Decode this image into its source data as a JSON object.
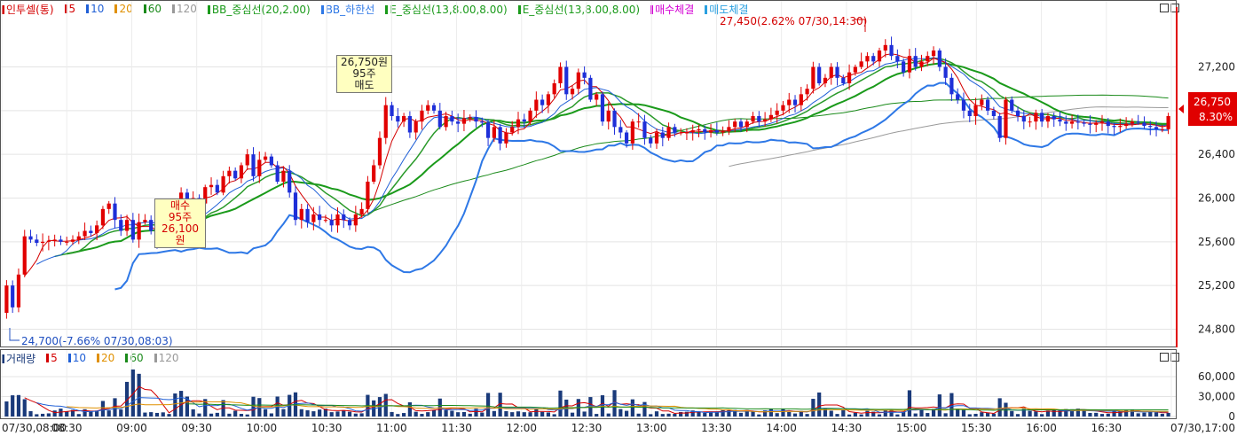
{
  "price_legend": {
    "items": [
      {
        "label": "인투셀(통)",
        "color": "#d40000"
      },
      {
        "label": "5",
        "color": "#d40000"
      },
      {
        "label": "10",
        "color": "#1f5fd6"
      },
      {
        "label": "20",
        "color": "#e09000"
      },
      {
        "label": "60",
        "color": "#1a8a1a"
      },
      {
        "label": "120",
        "color": "#999999"
      },
      {
        "label": "BB_중심선(20,2.00)",
        "color": "#1a9a1a"
      },
      {
        "label": "BB_하한선",
        "color": "#2e78e6"
      },
      {
        "label": "E_중심선(13,8.00,8.00)",
        "color": "#1a9a1a"
      },
      {
        "label": "E_중심선(13,8.00,8.00)",
        "color": "#1a9a1a"
      },
      {
        "label": "매수체결",
        "color": "#d400d4"
      },
      {
        "label": "매도체결",
        "color": "#2aa0e0"
      }
    ]
  },
  "volume_legend": {
    "items": [
      {
        "label": "거래량",
        "color": "#1a3a7a"
      },
      {
        "label": "5",
        "color": "#d40000"
      },
      {
        "label": "10",
        "color": "#1f5fd6"
      },
      {
        "label": "20",
        "color": "#e09000"
      },
      {
        "label": "60",
        "color": "#1a8a1a"
      },
      {
        "label": "120",
        "color": "#999999"
      }
    ]
  },
  "annotations": {
    "high": "27,450(2.62% 07/30,14:30)",
    "low": "24,700(-7.66% 07/30,08:03)",
    "sell_callout": [
      "26,750원",
      "95주",
      "매도"
    ],
    "buy_callout": [
      "매수",
      "95주",
      "26,100원"
    ],
    "current_price": "26,750",
    "current_change": "8.30%"
  },
  "chart_data": {
    "type": "candlestick",
    "y_ticks": [
      "27,200",
      "26,800",
      "26,400",
      "26,000",
      "25,600",
      "25,200",
      "24,800"
    ],
    "y_tick_values": [
      27200,
      26800,
      26400,
      26000,
      25600,
      25200,
      24800
    ],
    "volume_ticks": [
      "60,000",
      "30,000",
      "0"
    ],
    "volume_tick_values": [
      60000,
      30000,
      0
    ],
    "x_ticks": [
      "07/30,08:00",
      "08:30",
      "09:00",
      "09:30",
      "10:00",
      "10:30",
      "11:00",
      "11:30",
      "12:00",
      "12:30",
      "13:00",
      "13:30",
      "14:00",
      "14:30",
      "15:00",
      "15:30",
      "16:00",
      "16:30",
      "07/30,17:00"
    ],
    "closes": [
      25200,
      25000,
      25300,
      25650,
      25620,
      25590,
      25600,
      25610,
      25620,
      25600,
      25600,
      25620,
      25650,
      25700,
      25680,
      25750,
      25900,
      25950,
      25800,
      25700,
      25800,
      25620,
      25780,
      25800,
      25700,
      25600,
      25700,
      25680,
      25850,
      26050,
      25900,
      26000,
      25950,
      26100,
      26120,
      26050,
      26200,
      26250,
      26180,
      26300,
      26400,
      26200,
      26350,
      26380,
      26300,
      26150,
      26250,
      26050,
      25800,
      25900,
      25780,
      25850,
      25800,
      25800,
      25750,
      25850,
      25800,
      25750,
      25850,
      25900,
      26150,
      26300,
      26550,
      26850,
      26750,
      26700,
      26750,
      26600,
      26700,
      26800,
      26850,
      26800,
      26650,
      26750,
      26700,
      26680,
      26730,
      26740,
      26700,
      26690,
      26550,
      26650,
      26500,
      26600,
      26650,
      26720,
      26700,
      26800,
      26900,
      26850,
      26950,
      27050,
      27200,
      26950,
      27000,
      27150,
      27100,
      26900,
      26950,
      26700,
      26800,
      26650,
      26600,
      26500,
      26700,
      26700,
      26550,
      26500,
      26600,
      26550,
      26650,
      26600,
      26600,
      26600,
      26620,
      26630,
      26600,
      26620,
      26600,
      26610,
      26650,
      26700,
      26650,
      26700,
      26750,
      26700,
      26720,
      26760,
      26800,
      26850,
      26900,
      26850,
      26950,
      27000,
      27200,
      27050,
      27100,
      27200,
      27100,
      27050,
      27150,
      27200,
      27250,
      27300,
      27250,
      27350,
      27400,
      27300,
      27250,
      27150,
      27300,
      27200,
      27250,
      27300,
      27350,
      27200,
      27100,
      26950,
      26900,
      26800,
      26750,
      26850,
      26900,
      26800,
      26750,
      26550,
      26900,
      26800,
      26750,
      26700,
      26700,
      26780,
      26700,
      26750,
      26720,
      26700,
      26680,
      26700,
      26690,
      26680,
      26670,
      26690,
      26700,
      26660,
      26650,
      26660,
      26680,
      26700,
      26690,
      26660,
      26650,
      26630,
      26630,
      26750
    ]
  }
}
